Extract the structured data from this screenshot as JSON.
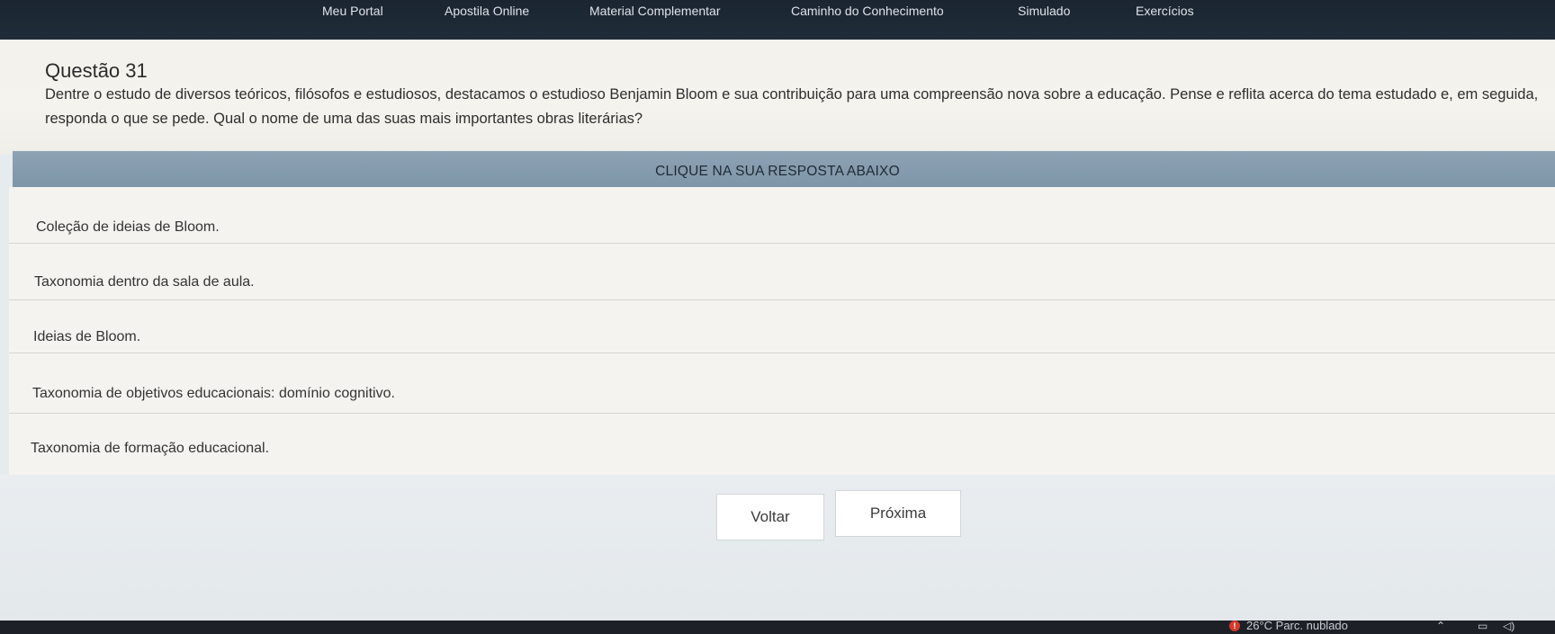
{
  "nav": {
    "items": [
      "Meu Portal",
      "Apostila Online",
      "Material Complementar",
      "Caminho do Conhecimento",
      "Simulado",
      "Exercícios"
    ]
  },
  "question": {
    "title": "Questão 31",
    "text": "Dentre o estudo de diversos teóricos, filósofos e estudiosos, destacamos o estudioso Benjamin Bloom e sua contribuição para uma compreensão nova sobre a educação. Pense e reflita acerca do tema estudado e, em seguida, responda o que se pede. Qual o nome de uma das suas mais importantes obras literárias?"
  },
  "cta": "CLIQUE NA SUA RESPOSTA ABAIXO",
  "answers": [
    "Coleção de ideias de Bloom.",
    "Taxonomia dentro da sala de aula.",
    "Ideias de Bloom.",
    "Taxonomia de objetivos educacionais: domínio cognitivo.",
    "Taxonomia de formação educacional."
  ],
  "buttons": {
    "back": "Voltar",
    "next": "Próxima"
  },
  "taskbar": {
    "weather": "26°C  Parc. nublado"
  }
}
